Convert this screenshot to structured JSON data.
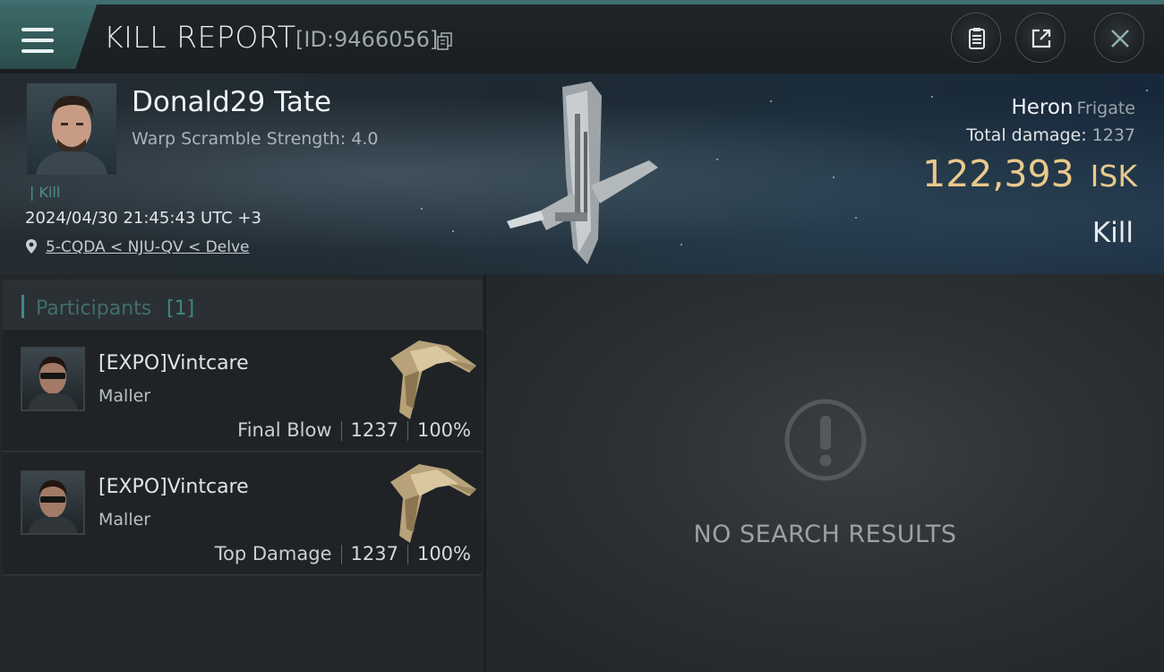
{
  "window": {
    "title": "KILL REPORT",
    "report_id": "[ID:9466056]"
  },
  "toolbar": {
    "menu_icon": "hamburger-icon",
    "copy_icon": "copy-icon",
    "clipboard_icon": "clipboard-icon",
    "share_icon": "share-icon",
    "close_icon": "close-icon"
  },
  "victim": {
    "name": "Donald29 Tate",
    "warp_scramble": "Warp Scramble Strength: 4.0",
    "tag": "| Kill",
    "datetime": "2024/04/30 21:45:43 UTC +3",
    "location": "5-CQDA < NJU-QV < Delve",
    "ship_name": "Heron",
    "ship_class": "Frigate",
    "total_damage_label": "Total damage:",
    "total_damage": "1237",
    "isk_value": "122,393",
    "isk_unit": "ISK",
    "result": "Kill"
  },
  "participants": {
    "title": "Participants",
    "count": "[1]",
    "rows": [
      {
        "name": "[EXPO]Vintcare",
        "ship": "Maller",
        "role": "Final Blow",
        "damage": "1237",
        "percent": "100%"
      },
      {
        "name": "[EXPO]Vintcare",
        "ship": "Maller",
        "role": "Top Damage",
        "damage": "1237",
        "percent": "100%"
      }
    ]
  },
  "results": {
    "empty_text": "NO SEARCH RESULTS",
    "icon": "alert-icon"
  },
  "colors": {
    "accent_teal": "#3c8c88",
    "isk_gold": "#e9c98c",
    "menu_tab": "#3c6a68"
  }
}
